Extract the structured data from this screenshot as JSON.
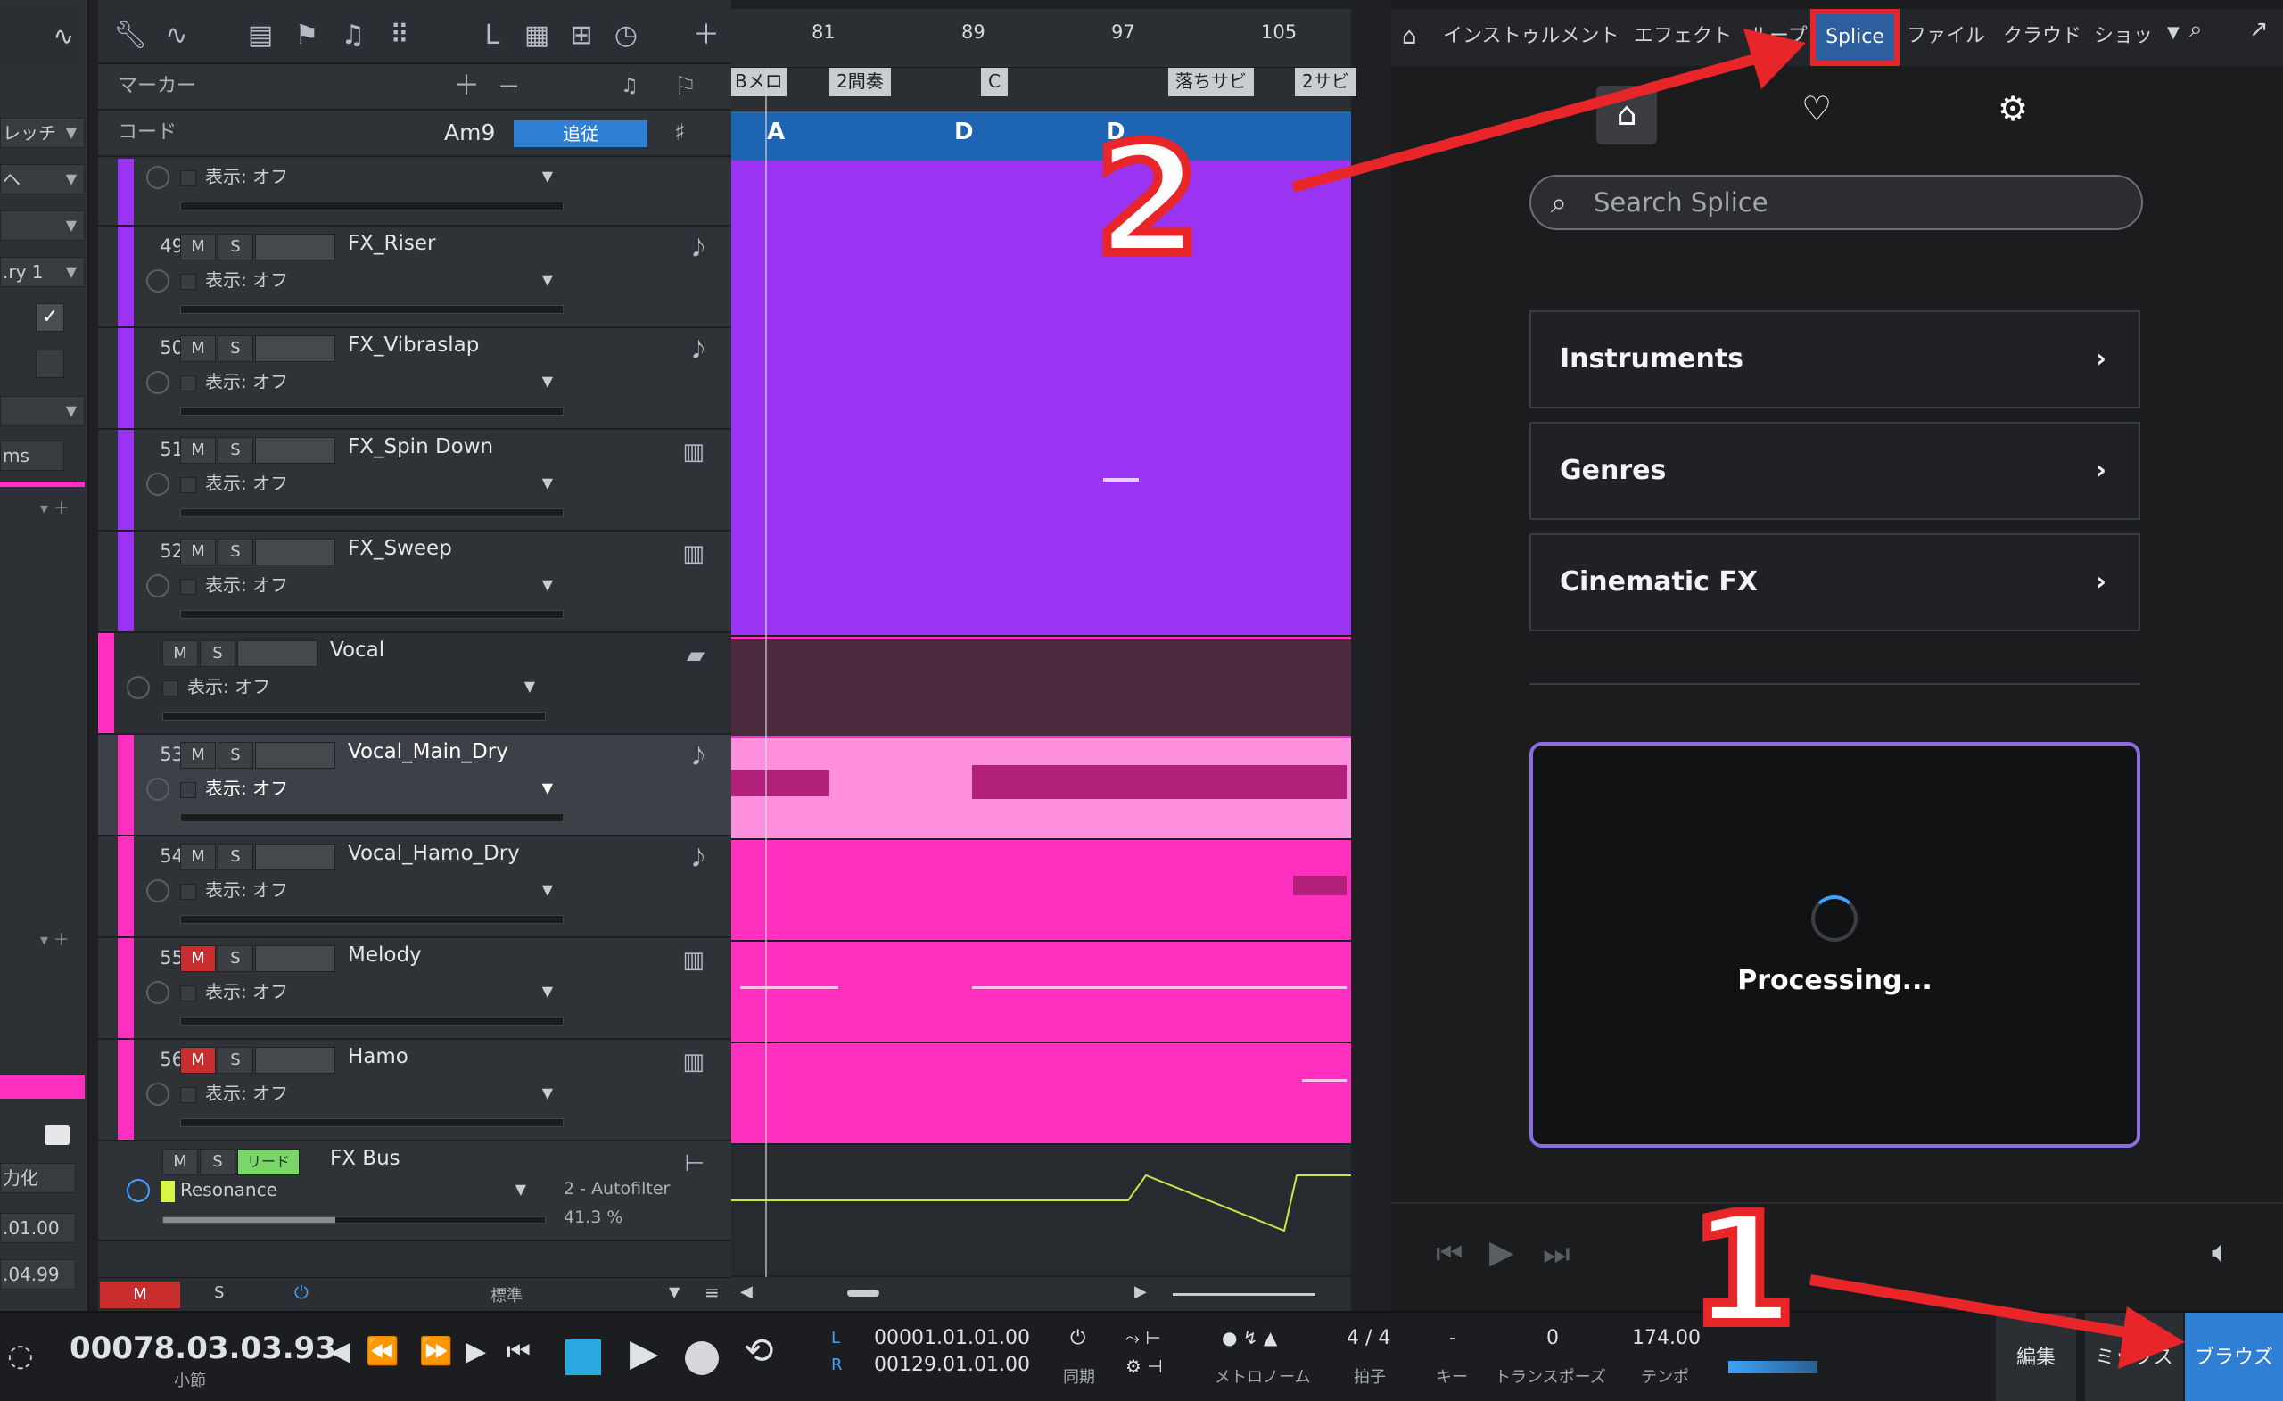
{
  "left_strip": {
    "items": [
      "レッチ",
      "ヘ",
      "",
      ".ry 1",
      "",
      "",
      "",
      "ms",
      "",
      "",
      "",
      "力化",
      ".01.00",
      ".04.99"
    ]
  },
  "track_header": {
    "marker_label": "マーカー",
    "chord_label": "コード",
    "chord_value": "Am9",
    "follow_label": "追従"
  },
  "tracks": [
    {
      "num": "",
      "name": "",
      "display": "表示: オフ",
      "color": "#9b34f2"
    },
    {
      "num": "49",
      "name": "FX_Riser",
      "display": "表示: オフ",
      "color": "#9b34f2",
      "icon": "waveform-icon"
    },
    {
      "num": "50",
      "name": "FX_Vibraslap",
      "display": "表示: オフ",
      "color": "#9b34f2",
      "icon": "waveform-icon"
    },
    {
      "num": "51",
      "name": "FX_Spin Down",
      "display": "表示: オフ",
      "color": "#9b34f2",
      "icon": "keyboard-icon"
    },
    {
      "num": "52",
      "name": "FX_Sweep",
      "display": "表示: オフ",
      "color": "#9b34f2",
      "icon": "keyboard-icon"
    },
    {
      "num": "",
      "name": "Vocal",
      "display": "表示: オフ",
      "color": "#ff2fbf",
      "icon": "folder-icon"
    },
    {
      "num": "53",
      "name": "Vocal_Main_Dry",
      "display": "表示: オフ",
      "color": "#ff2fbf",
      "icon": "waveform-icon",
      "selected": true
    },
    {
      "num": "54",
      "name": "Vocal_Hamo_Dry",
      "display": "表示: オフ",
      "color": "#ff2fbf",
      "icon": "waveform-icon"
    },
    {
      "num": "55",
      "name": "Melody",
      "display": "表示: オフ",
      "color": "#ff2fbf",
      "icon": "keyboard-icon",
      "muted": true
    },
    {
      "num": "56",
      "name": "Hamo",
      "display": "表示: オフ",
      "color": "#ff2fbf",
      "icon": "keyboard-icon",
      "muted": true
    }
  ],
  "fx_bus": {
    "name": "FX Bus",
    "lead_label": "リード",
    "param": "Resonance",
    "plugin": "2 - Autofilter",
    "value": "41.3 %"
  },
  "track_footer": {
    "m": "M",
    "s": "S",
    "preset": "標準"
  },
  "ruler": {
    "bars": [
      "81",
      "89",
      "97",
      "105"
    ]
  },
  "markers": [
    "Bメロ",
    "2間奏",
    "C",
    "落ちサビ",
    "2サビ"
  ],
  "chords": [
    "A",
    "D",
    "D"
  ],
  "browser": {
    "tabs": [
      "インストゥルメント",
      "エフェクト",
      "ループ",
      "Splice",
      "ファイル",
      "クラウド",
      "ショッ"
    ],
    "active_tab": "Splice",
    "search_placeholder": "Search Splice",
    "categories": [
      "Instruments",
      "Genres",
      "Cinematic FX"
    ],
    "processing_text": "Processing..."
  },
  "transport": {
    "position": "00078.03.03.93",
    "position_label": "小節",
    "loop_l": "00001.01.01.00",
    "loop_r": "00129.01.01.00",
    "sync_label": "同期",
    "metronome_label": "メトロノーム",
    "time_sig": "4 / 4",
    "time_sig_label": "拍子",
    "key": "-",
    "key_label": "キー",
    "transpose": "0",
    "transpose_label": "トランスポーズ",
    "tempo": "174.00",
    "tempo_label": "テンポ",
    "edit_tab": "編集",
    "mix_tab": "ミックス",
    "browse_tab": "ブラウズ"
  },
  "annotations": {
    "step1": "1",
    "step2": "2"
  },
  "colors": {
    "accent_red": "#e8262a",
    "purple_track": "#9b34f2",
    "pink_track": "#ff2fbf",
    "chord_blue": "#1d64b3"
  }
}
